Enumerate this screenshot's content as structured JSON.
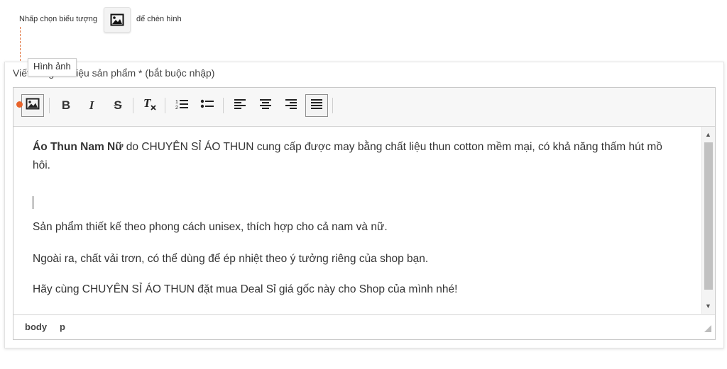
{
  "hint": {
    "text_before": "Nhấp chọn biểu tượng",
    "text_after": "để chèn hình",
    "icon": "image-icon"
  },
  "section": {
    "title": "Viết bài giới thiệu sản phẩm * (bắt buộc nhập)"
  },
  "toolbar": {
    "buttons": [
      {
        "name": "image",
        "icon": "image-icon",
        "tooltip": "Hình ảnh"
      },
      {
        "name": "bold",
        "icon": "bold-icon",
        "glyph": "B"
      },
      {
        "name": "italic",
        "icon": "italic-icon",
        "glyph": "I"
      },
      {
        "name": "strikethrough",
        "icon": "strikethrough-icon",
        "glyph": "S"
      },
      {
        "name": "remove-format",
        "icon": "clear-format-icon",
        "glyph": "T"
      },
      {
        "name": "numbered-list",
        "icon": "numbered-list-icon"
      },
      {
        "name": "bullet-list",
        "icon": "bullet-list-icon"
      },
      {
        "name": "align-left",
        "icon": "align-left-icon"
      },
      {
        "name": "align-center",
        "icon": "align-center-icon"
      },
      {
        "name": "align-right",
        "icon": "align-right-icon"
      },
      {
        "name": "justify",
        "icon": "justify-icon",
        "active": true
      }
    ],
    "tooltip": "Hình ảnh"
  },
  "content": {
    "p1_bold": "Áo Thun Nam Nữ",
    "p1_rest": " do CHUYÊN SỈ ÁO THUN cung cấp được may bằng chất liệu thun cotton mềm mại, có khả năng thấm hút mồ hôi.",
    "p2": "Sản phẩm thiết kế theo phong cách unisex, thích hợp cho cả nam và nữ.",
    "p3": "Ngoài ra, chất vải trơn, có thể dùng để ép nhiệt theo ý tưởng riêng của shop bạn.",
    "p4": "Hãy cùng CHUYÊN SỈ ÁO THUN đặt mua Deal Sỉ giá gốc này cho Shop của mình nhé!"
  },
  "statusbar": {
    "path": [
      "body",
      "p"
    ]
  },
  "colors": {
    "accent_dot": "#e8642c",
    "dashed_line": "#e0703a"
  }
}
